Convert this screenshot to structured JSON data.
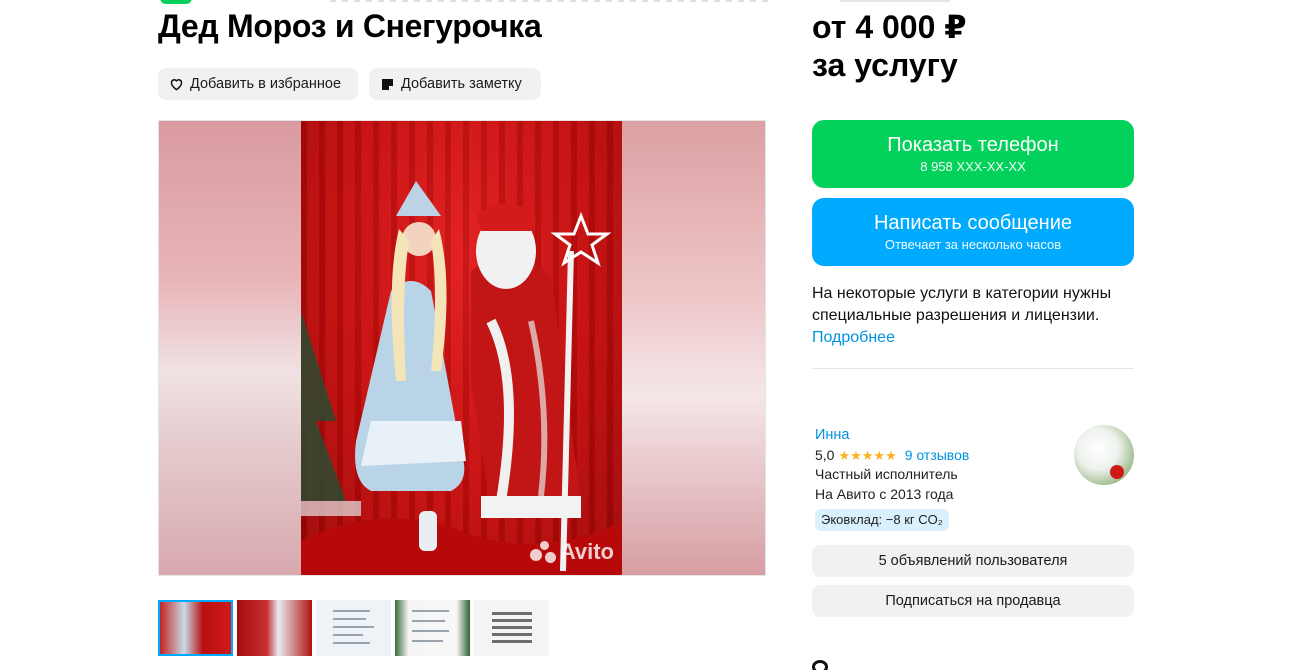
{
  "listing": {
    "title": "Дед Мороз и Снегурочка"
  },
  "actions": {
    "favorite_label": "Добавить в избранное",
    "note_label": "Добавить заметку"
  },
  "gallery": {
    "watermark": "Avito",
    "thumbnails": [
      {
        "name": "thumb-1",
        "active": true
      },
      {
        "name": "thumb-2",
        "active": false
      },
      {
        "name": "thumb-3",
        "active": false
      },
      {
        "name": "thumb-4",
        "active": false
      },
      {
        "name": "thumb-5",
        "active": false
      }
    ]
  },
  "price": {
    "line1": "от 4 000 ₽",
    "line2": "за услугу"
  },
  "contact": {
    "phone_label": "Показать телефон",
    "phone_masked": "8 958 XXX-XX-XX",
    "message_label": "Написать сообщение",
    "message_sub": "Отвечает за несколько часов"
  },
  "notice": {
    "text": "На некоторые услуги в категории нужны специальные разрешения и лицензии.",
    "link": "Подробнее"
  },
  "seller": {
    "name": "Инна",
    "rating": "5,0",
    "stars": "★★★★★",
    "reviews": "9 отзывов",
    "type": "Частный исполнитель",
    "since": "На Авито с 2013 года",
    "eco": "Эковклад: −8 кг CO₂",
    "ads_button": "5 объявлений пользователя",
    "subscribe_button": "Подписаться на продавца"
  },
  "colors": {
    "green": "#02d15c",
    "blue": "#00aaff",
    "link": "#0093e0",
    "chip_bg": "#f2f1ef",
    "star": "#ffb021"
  }
}
